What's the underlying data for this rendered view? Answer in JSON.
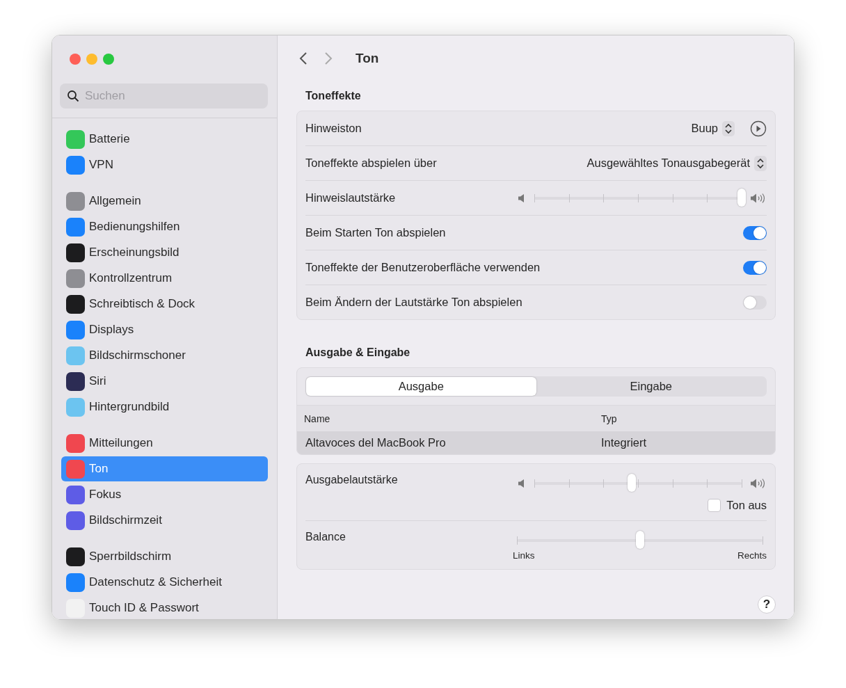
{
  "window": {
    "title": "Ton"
  },
  "search": {
    "placeholder": "Suchen"
  },
  "sidebar": {
    "groups": [
      [
        {
          "label": "Batterie",
          "color": "#34c759",
          "selected": false
        },
        {
          "label": "VPN",
          "color": "#1a82fb",
          "selected": false
        }
      ],
      [
        {
          "label": "Allgemein",
          "color": "#8e8e93",
          "selected": false
        },
        {
          "label": "Bedienungshilfen",
          "color": "#1a82fb",
          "selected": false
        },
        {
          "label": "Erscheinungsbild",
          "color": "#1c1c1e",
          "selected": false
        },
        {
          "label": "Kontrollzentrum",
          "color": "#8e8e93",
          "selected": false
        },
        {
          "label": "Schreibtisch & Dock",
          "color": "#1c1c1e",
          "selected": false
        },
        {
          "label": "Displays",
          "color": "#1a82fb",
          "selected": false
        },
        {
          "label": "Bildschirmschoner",
          "color": "#6cc4f0",
          "selected": false
        },
        {
          "label": "Siri",
          "color": "#2c2c54",
          "selected": false
        },
        {
          "label": "Hintergrundbild",
          "color": "#6cc4f0",
          "selected": false
        }
      ],
      [
        {
          "label": "Mitteilungen",
          "color": "#f0474f",
          "selected": false
        },
        {
          "label": "Ton",
          "color": "#f0474f",
          "selected": true
        },
        {
          "label": "Fokus",
          "color": "#5e5ce6",
          "selected": false
        },
        {
          "label": "Bildschirmzeit",
          "color": "#5e5ce6",
          "selected": false
        }
      ],
      [
        {
          "label": "Sperrbildschirm",
          "color": "#1c1c1e",
          "selected": false
        },
        {
          "label": "Datenschutz & Sicherheit",
          "color": "#1a82fb",
          "selected": false
        },
        {
          "label": "Touch ID & Passwort",
          "color": "#f2f2f2",
          "selected": false
        }
      ]
    ]
  },
  "sound_effects": {
    "heading": "Toneffekte",
    "rows": [
      {
        "kind": "popup",
        "label": "Hinweiston",
        "value": "Buup",
        "play": true
      },
      {
        "kind": "popup",
        "label": "Toneffekte abspielen über",
        "value": "Ausgewähltes Tonausgabegerät",
        "play": false
      },
      {
        "kind": "slider",
        "label": "Hinweislautstärke",
        "level": 1.0
      },
      {
        "kind": "toggle",
        "label": "Beim Starten Ton abspielen",
        "on": true
      },
      {
        "kind": "toggle",
        "label": "Toneffekte der Benutzeroberfläche verwenden",
        "on": true
      },
      {
        "kind": "toggle",
        "label": "Beim Ändern der Lautstärke Ton abspielen",
        "on": false
      }
    ]
  },
  "output_input": {
    "heading": "Ausgabe & Eingabe",
    "tabs": [
      {
        "label": "Ausgabe",
        "selected": true
      },
      {
        "label": "Eingabe",
        "selected": false
      }
    ],
    "table": {
      "columns": [
        "Name",
        "Typ"
      ],
      "rows": [
        {
          "cells": [
            "Altavoces del MacBook Pro",
            "Integriert"
          ],
          "selected": true
        }
      ]
    },
    "volume": {
      "label": "Ausgabelautstärke",
      "level": 0.47,
      "mute_label": "Ton aus",
      "muted": false
    },
    "balance": {
      "label": "Balance",
      "level": 0.5,
      "min_label": "Links",
      "max_label": "Rechts"
    }
  },
  "help": "?"
}
